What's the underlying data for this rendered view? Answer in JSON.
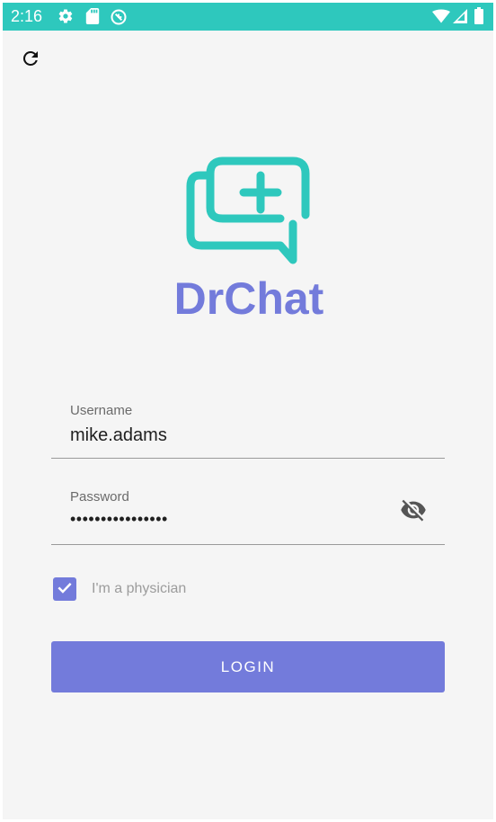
{
  "status_bar": {
    "time": "2:16",
    "left_icons": [
      "settings-icon",
      "sd-card-icon",
      "data-saver-icon"
    ],
    "right_icons": [
      "wifi-icon",
      "signal-icon",
      "battery-icon"
    ]
  },
  "toolbar": {
    "refresh_icon": "refresh-icon"
  },
  "logo": {
    "text": "DrChat",
    "color_primary": "#2ec8bd",
    "color_text": "#737bdb"
  },
  "form": {
    "username": {
      "label": "Username",
      "value": "mike.adams"
    },
    "password": {
      "label": "Password",
      "value": "••••••••••••••••",
      "toggle_icon": "visibility-off-icon"
    },
    "physician_checkbox": {
      "label": "I'm a physician",
      "checked": true
    },
    "login_button": {
      "label": "LOGIN"
    }
  },
  "colors": {
    "status_bar": "#2ec8bd",
    "accent": "#737bdb",
    "background": "#f5f5f5"
  }
}
